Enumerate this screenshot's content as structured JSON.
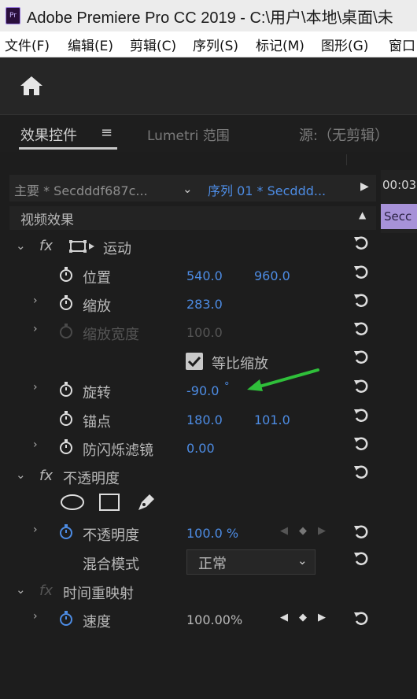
{
  "window": {
    "title": "Adobe Premiere Pro CC 2019 - C:\\用户\\本地\\桌面\\未",
    "app_icon": "Pr"
  },
  "menu": [
    "文件(F)",
    "编辑(E)",
    "剪辑(C)",
    "序列(S)",
    "标记(M)",
    "图形(G)",
    "窗口"
  ],
  "tabs": {
    "effects": "效果控件",
    "effects_menu": "≡",
    "lumetri": "Lumetri 范围",
    "source": "源:（无剪辑）"
  },
  "clip_header": {
    "master": "主要 * Secdddf687c...",
    "sequence": "序列 01 * Secddd...",
    "timecode": "00:03",
    "clip_label": "Secc"
  },
  "section": {
    "video_effects": "视频效果"
  },
  "motion": {
    "name": "运动",
    "position": {
      "label": "位置",
      "x": "540.0",
      "y": "960.0"
    },
    "scale": {
      "label": "缩放",
      "value": "283.0"
    },
    "scale_width": {
      "label": "缩放宽度",
      "value": "100.0"
    },
    "uniform_scale": {
      "label": "等比缩放",
      "checked": true
    },
    "rotation": {
      "label": "旋转",
      "value": "-90.0",
      "unit": "°"
    },
    "anchor": {
      "label": "锚点",
      "x": "180.0",
      "y": "101.0"
    },
    "anti_flicker": {
      "label": "防闪烁滤镜",
      "value": "0.00"
    }
  },
  "opacity": {
    "name": "不透明度",
    "opacity_param": {
      "label": "不透明度",
      "value": "100.0 %"
    },
    "blend_mode": {
      "label": "混合模式",
      "value": "正常"
    }
  },
  "time_remap": {
    "name": "时间重映射",
    "speed": {
      "label": "速度",
      "value": "100.00%"
    }
  },
  "fx_label": "fx",
  "colors": {
    "value_blue": "#4d8ce4",
    "annotation_arrow": "#2fbf3a",
    "clip_purple": "#a792d8"
  }
}
